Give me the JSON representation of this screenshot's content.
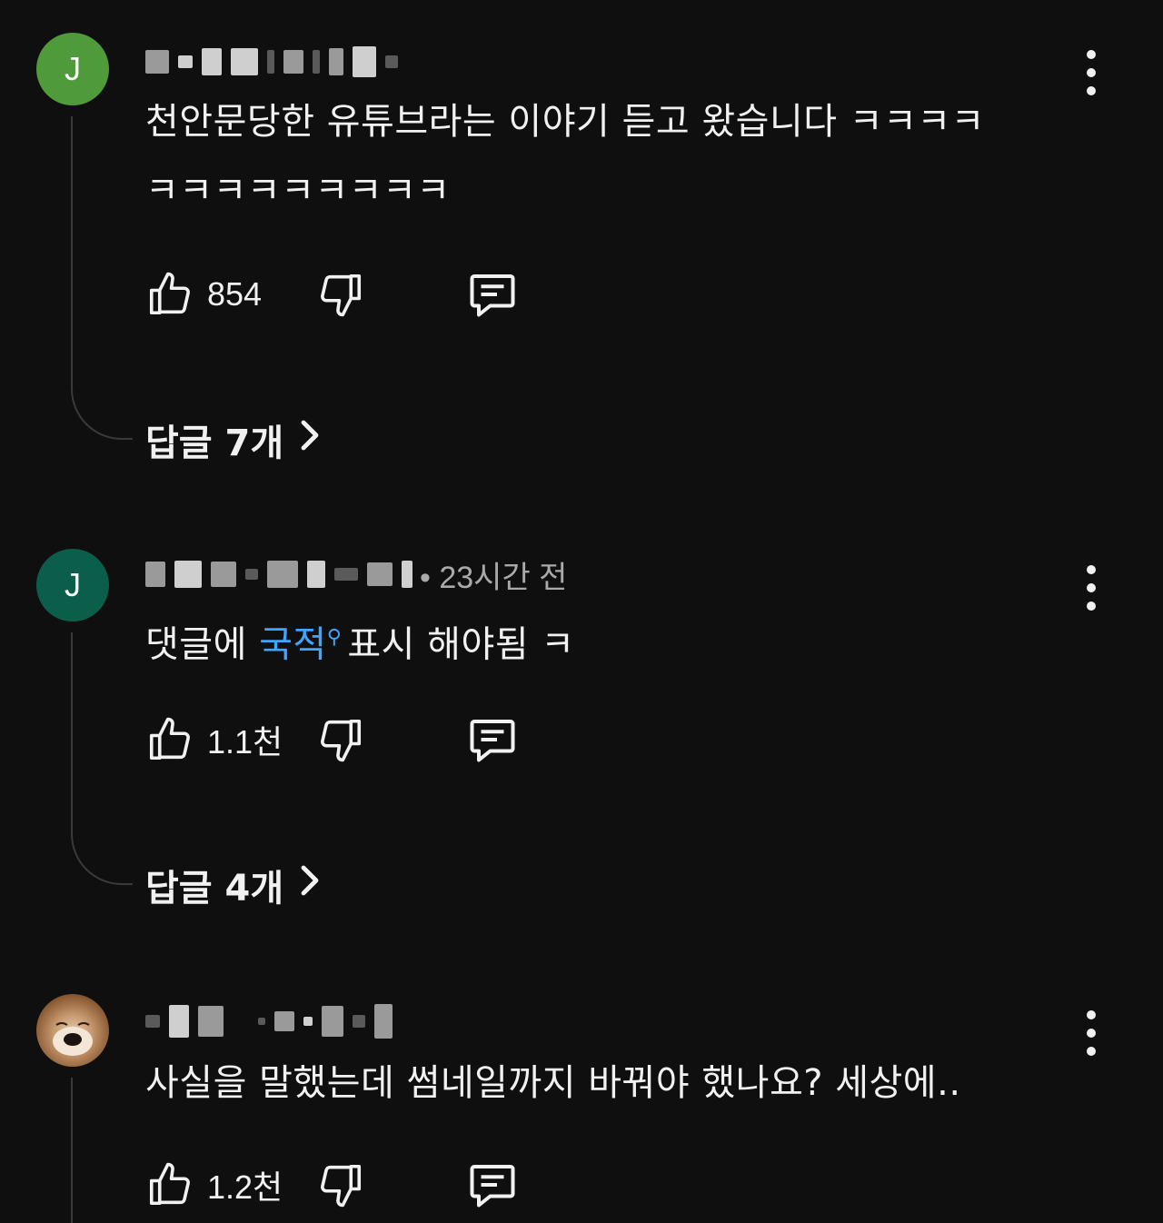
{
  "comments": [
    {
      "avatar_letter": "J",
      "avatar_color": "#4f9a3a",
      "time": "",
      "text_line1": "천안문당한 유튜브라는 이야기 듣고 왔습니다 ㅋㅋㅋㅋ",
      "text_line2": "ㅋㅋㅋㅋㅋㅋㅋㅋㅋ",
      "likes": "854",
      "replies_label": "답글 7개"
    },
    {
      "avatar_letter": "J",
      "avatar_color": "#0b5f4a",
      "time": "• 23시간 전",
      "text_before": "댓글에 ",
      "text_link": "국적",
      "text_after": "표시 해야됨 ㅋ",
      "likes": "1.1천",
      "replies_label": "답글 4개"
    },
    {
      "avatar_desc": "dog-photo",
      "time": "",
      "text_line1": "사실을 말했는데 썸네일까지 바꿔야 했나요? 세상에..",
      "likes": "1.2천"
    }
  ],
  "colors": {
    "background": "#0f0f0f",
    "text": "#f1f1f1",
    "link": "#3ea6ff",
    "meta": "#aaaaaa"
  },
  "icons": [
    "thumbs-up-icon",
    "thumbs-down-icon",
    "reply-icon",
    "more-vert-icon",
    "chevron-right-icon",
    "search-link-icon"
  ]
}
